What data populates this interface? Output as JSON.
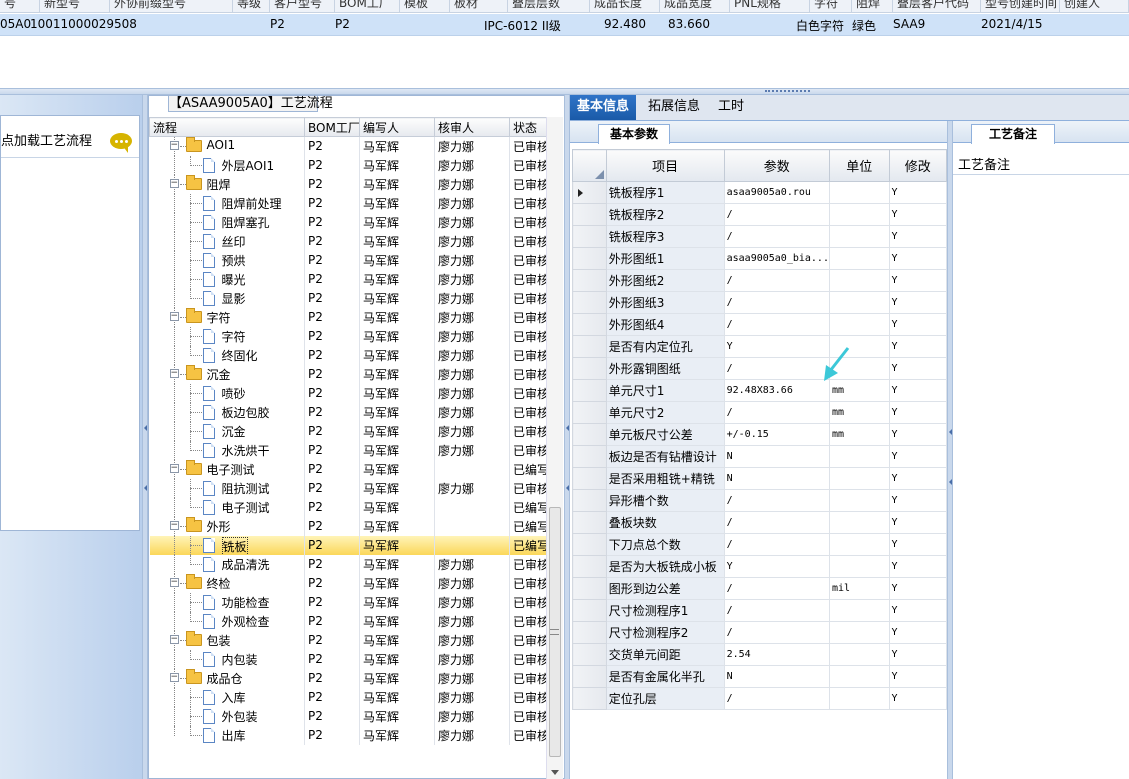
{
  "top_grid": {
    "headers": [
      "号",
      "新型号",
      "外协前缀型号",
      "等级",
      "客户型号",
      "BOM工厂",
      "模板",
      "板材",
      "叠层层数",
      "成品长度",
      "成品宽度",
      "PNL规格",
      "字符",
      "阻焊",
      "叠层客户代码",
      "型号创建时间",
      "创建人"
    ],
    "row": {
      "code": "05A0",
      "bom_no": "10011000029508",
      "factory_a": "P2",
      "factory_b": "P2",
      "grade": "IPC-6012 II级",
      "length": "92.480",
      "width": "83.660",
      "char_color": "白色字符",
      "solder_color": "绿色",
      "code2": "SAA9",
      "date": "2021/4/15"
    }
  },
  "left_panel": {
    "label": "点加载工艺流程"
  },
  "process_tree": {
    "title": "【ASAA9005A0】工艺流程",
    "headers": [
      "流程",
      "BOM工厂",
      "编写人",
      "核审人",
      "状态"
    ],
    "rows": [
      {
        "level": 1,
        "type": "folder",
        "name": "AOI1",
        "factory": "P2",
        "writer": "马军辉",
        "reviewer": "廖力娜",
        "status": "已审核"
      },
      {
        "level": 2,
        "type": "doc",
        "name": "外层AOI1",
        "factory": "P2",
        "writer": "马军辉",
        "reviewer": "廖力娜",
        "status": "已审核"
      },
      {
        "level": 1,
        "type": "folder",
        "name": "阻焊",
        "factory": "P2",
        "writer": "马军辉",
        "reviewer": "廖力娜",
        "status": "已审核"
      },
      {
        "level": 2,
        "type": "doc",
        "name": "阻焊前处理",
        "factory": "P2",
        "writer": "马军辉",
        "reviewer": "廖力娜",
        "status": "已审核"
      },
      {
        "level": 2,
        "type": "doc",
        "name": "阻焊塞孔",
        "factory": "P2",
        "writer": "马军辉",
        "reviewer": "廖力娜",
        "status": "已审核"
      },
      {
        "level": 2,
        "type": "doc",
        "name": "丝印",
        "factory": "P2",
        "writer": "马军辉",
        "reviewer": "廖力娜",
        "status": "已审核"
      },
      {
        "level": 2,
        "type": "doc",
        "name": "预烘",
        "factory": "P2",
        "writer": "马军辉",
        "reviewer": "廖力娜",
        "status": "已审核"
      },
      {
        "level": 2,
        "type": "doc",
        "name": "曝光",
        "factory": "P2",
        "writer": "马军辉",
        "reviewer": "廖力娜",
        "status": "已审核"
      },
      {
        "level": 2,
        "type": "doc",
        "name": "显影",
        "factory": "P2",
        "writer": "马军辉",
        "reviewer": "廖力娜",
        "status": "已审核"
      },
      {
        "level": 1,
        "type": "folder",
        "name": "字符",
        "factory": "P2",
        "writer": "马军辉",
        "reviewer": "廖力娜",
        "status": "已审核"
      },
      {
        "level": 2,
        "type": "doc",
        "name": "字符",
        "factory": "P2",
        "writer": "马军辉",
        "reviewer": "廖力娜",
        "status": "已审核"
      },
      {
        "level": 2,
        "type": "doc",
        "name": "终固化",
        "factory": "P2",
        "writer": "马军辉",
        "reviewer": "廖力娜",
        "status": "已审核"
      },
      {
        "level": 1,
        "type": "folder",
        "name": "沉金",
        "factory": "P2",
        "writer": "马军辉",
        "reviewer": "廖力娜",
        "status": "已审核"
      },
      {
        "level": 2,
        "type": "doc",
        "name": "喷砂",
        "factory": "P2",
        "writer": "马军辉",
        "reviewer": "廖力娜",
        "status": "已审核"
      },
      {
        "level": 2,
        "type": "doc",
        "name": "板边包胶",
        "factory": "P2",
        "writer": "马军辉",
        "reviewer": "廖力娜",
        "status": "已审核"
      },
      {
        "level": 2,
        "type": "doc",
        "name": "沉金",
        "factory": "P2",
        "writer": "马军辉",
        "reviewer": "廖力娜",
        "status": "已审核"
      },
      {
        "level": 2,
        "type": "doc",
        "name": "水洗烘干",
        "factory": "P2",
        "writer": "马军辉",
        "reviewer": "廖力娜",
        "status": "已审核"
      },
      {
        "level": 1,
        "type": "folder",
        "name": "电子测试",
        "factory": "P2",
        "writer": "马军辉",
        "reviewer": "",
        "status": "已编写"
      },
      {
        "level": 2,
        "type": "doc",
        "name": "阻抗测试",
        "factory": "P2",
        "writer": "马军辉",
        "reviewer": "廖力娜",
        "status": "已审核"
      },
      {
        "level": 2,
        "type": "doc",
        "name": "电子测试",
        "factory": "P2",
        "writer": "马军辉",
        "reviewer": "",
        "status": "已编写"
      },
      {
        "level": 1,
        "type": "folder",
        "name": "外形",
        "factory": "P2",
        "writer": "马军辉",
        "reviewer": "",
        "status": "已编写"
      },
      {
        "level": 2,
        "type": "doc",
        "name": "铣板",
        "factory": "P2",
        "writer": "马军辉",
        "reviewer": "",
        "status": "已编写",
        "selected": true
      },
      {
        "level": 2,
        "type": "doc",
        "name": "成品清洗",
        "factory": "P2",
        "writer": "马军辉",
        "reviewer": "廖力娜",
        "status": "已审核"
      },
      {
        "level": 1,
        "type": "folder",
        "name": "终检",
        "factory": "P2",
        "writer": "马军辉",
        "reviewer": "廖力娜",
        "status": "已审核"
      },
      {
        "level": 2,
        "type": "doc",
        "name": "功能检查",
        "factory": "P2",
        "writer": "马军辉",
        "reviewer": "廖力娜",
        "status": "已审核"
      },
      {
        "level": 2,
        "type": "doc",
        "name": "外观检查",
        "factory": "P2",
        "writer": "马军辉",
        "reviewer": "廖力娜",
        "status": "已审核"
      },
      {
        "level": 1,
        "type": "folder",
        "name": "包装",
        "factory": "P2",
        "writer": "马军辉",
        "reviewer": "廖力娜",
        "status": "已审核"
      },
      {
        "level": 2,
        "type": "doc",
        "name": "内包装",
        "factory": "P2",
        "writer": "马军辉",
        "reviewer": "廖力娜",
        "status": "已审核"
      },
      {
        "level": 1,
        "type": "folder",
        "name": "成品仓",
        "factory": "P2",
        "writer": "马军辉",
        "reviewer": "廖力娜",
        "status": "已审核"
      },
      {
        "level": 2,
        "type": "doc",
        "name": "入库",
        "factory": "P2",
        "writer": "马军辉",
        "reviewer": "廖力娜",
        "status": "已审核"
      },
      {
        "level": 2,
        "type": "doc",
        "name": "外包装",
        "factory": "P2",
        "writer": "马军辉",
        "reviewer": "廖力娜",
        "status": "已审核"
      },
      {
        "level": 2,
        "type": "doc",
        "name": "出库",
        "factory": "P2",
        "writer": "马军辉",
        "reviewer": "廖力娜",
        "status": "已审核",
        "last": true
      }
    ]
  },
  "right_tabs": [
    "基本信息",
    "拓展信息",
    "工时"
  ],
  "params": {
    "tab_label": "基本参数",
    "headers": [
      "项目",
      "参数",
      "单位",
      "修改"
    ],
    "rows": [
      {
        "item": "铣板程序1",
        "value": "asaa9005a0.rou",
        "unit": "",
        "mod": "Y",
        "current": true
      },
      {
        "item": "铣板程序2",
        "value": "/",
        "unit": "",
        "mod": "Y"
      },
      {
        "item": "铣板程序3",
        "value": "/",
        "unit": "",
        "mod": "Y"
      },
      {
        "item": "外形图纸1",
        "value": "asaa9005a0_bia...",
        "unit": "",
        "mod": "Y"
      },
      {
        "item": "外形图纸2",
        "value": "/",
        "unit": "",
        "mod": "Y"
      },
      {
        "item": "外形图纸3",
        "value": "/",
        "unit": "",
        "mod": "Y"
      },
      {
        "item": "外形图纸4",
        "value": "/",
        "unit": "",
        "mod": "Y"
      },
      {
        "item": "是否有内定位孔",
        "value": "Y",
        "unit": "",
        "mod": "Y"
      },
      {
        "item": "外形露铜图纸",
        "value": "/",
        "unit": "",
        "mod": "Y"
      },
      {
        "item": "单元尺寸1",
        "value": "92.48X83.66",
        "unit": "mm",
        "mod": "Y"
      },
      {
        "item": "单元尺寸2",
        "value": "/",
        "unit": "mm",
        "mod": "Y"
      },
      {
        "item": "单元板尺寸公差",
        "value": "+/-0.15",
        "unit": "mm",
        "mod": "Y"
      },
      {
        "item": "板边是否有钻槽设计",
        "value": "N",
        "unit": "",
        "mod": "Y"
      },
      {
        "item": "是否采用粗铣+精铣",
        "value": "N",
        "unit": "",
        "mod": "Y"
      },
      {
        "item": "异形槽个数",
        "value": "/",
        "unit": "",
        "mod": "Y"
      },
      {
        "item": "叠板块数",
        "value": "/",
        "unit": "",
        "mod": "Y"
      },
      {
        "item": "下刀点总个数",
        "value": "/",
        "unit": "",
        "mod": "Y"
      },
      {
        "item": "是否为大板铣成小板",
        "value": "Y",
        "unit": "",
        "mod": "Y"
      },
      {
        "item": "图形到边公差",
        "value": "/",
        "unit": "mil",
        "mod": "Y"
      },
      {
        "item": "尺寸检测程序1",
        "value": "/",
        "unit": "",
        "mod": "Y"
      },
      {
        "item": "尺寸检测程序2",
        "value": "/",
        "unit": "",
        "mod": "Y"
      },
      {
        "item": "交货单元间距",
        "value": "2.54",
        "unit": "",
        "mod": "Y"
      },
      {
        "item": "是否有金属化半孔",
        "value": "N",
        "unit": "",
        "mod": "Y"
      },
      {
        "item": "定位孔层",
        "value": "/",
        "unit": "",
        "mod": "Y"
      }
    ]
  },
  "notes": {
    "tab_label": "工艺备注",
    "label": "工艺备注"
  },
  "colors": {
    "selected_row": "#fbd75a",
    "active_tab": "#1a5aa8",
    "top_row": "#cfe2f8",
    "cursor": "#3cc8d8"
  }
}
